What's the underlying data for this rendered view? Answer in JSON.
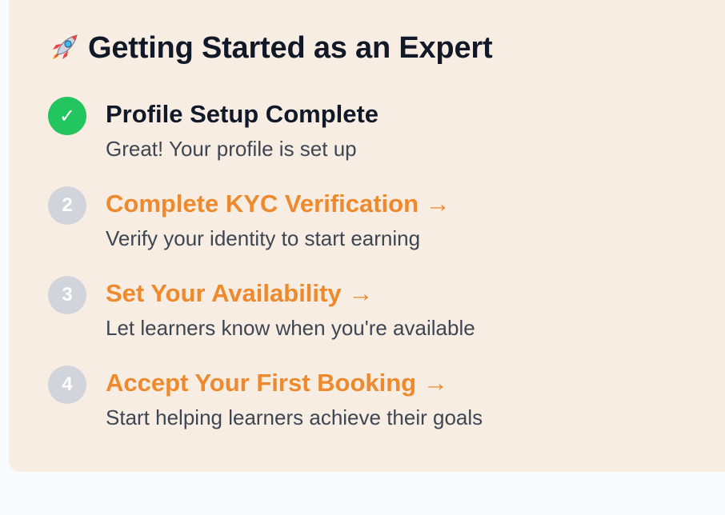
{
  "panel": {
    "title_icon": "rocket-icon",
    "title": "Getting Started as an Expert"
  },
  "steps": [
    {
      "status": "complete",
      "badge_icon": "checkmark-icon",
      "badge": "✓",
      "title": "Profile Setup Complete",
      "description": "Great! Your profile is set up"
    },
    {
      "status": "pending",
      "badge": "2",
      "title": "Complete KYC Verification →",
      "description": "Verify your identity to start earning"
    },
    {
      "status": "pending",
      "badge": "3",
      "title": "Set Your Availability →",
      "description": "Let learners know when you're available"
    },
    {
      "status": "pending",
      "badge": "4",
      "title": "Accept Your First Booking →",
      "description": "Start helping learners achieve their goals"
    }
  ],
  "colors": {
    "panel_background": "#f7ede3",
    "page_background": "#f8fafc",
    "complete_badge": "#22c55e",
    "pending_badge": "#d1d5db",
    "link_orange": "#ee8a2d",
    "heading": "#111827",
    "body_text": "#3f4653"
  }
}
